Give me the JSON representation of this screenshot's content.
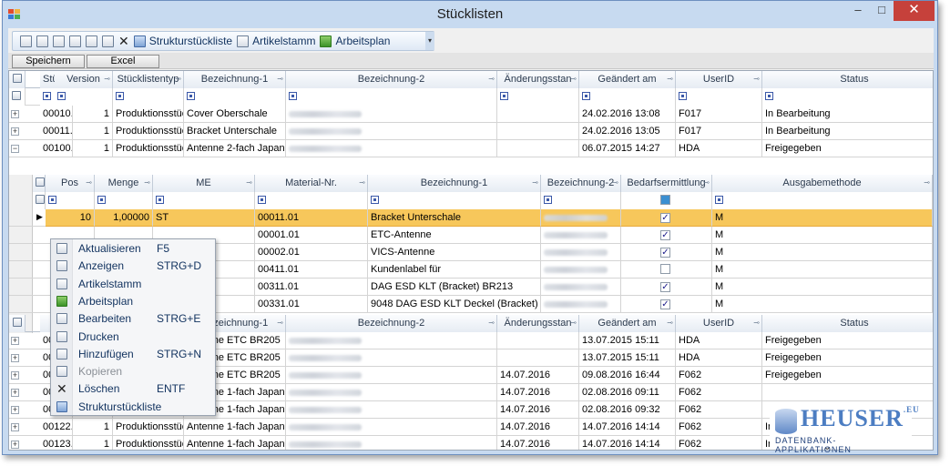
{
  "window": {
    "title": "Stücklisten",
    "min": "–",
    "max": "□",
    "close": "✕"
  },
  "toolbar": {
    "strukt": "Strukturstückliste",
    "artikel": "Artikelstamm",
    "arbeitsplan": "Arbeitsplan",
    "chevron": "▾"
  },
  "buttons": {
    "save": "Speichern",
    "excel": "Excel"
  },
  "grid": {
    "headers": [
      "Stücklisten",
      "Version",
      "Stücklistentyp",
      "Bezeichnung-1",
      "Bezeichnung-2",
      "Änderungsstan",
      "Geändert am",
      "UserID",
      "Status"
    ],
    "rows": [
      [
        "00010.01",
        "1",
        "Produktionsstückliste",
        "Cover Oberschale",
        "",
        "",
        "24.02.2016 13:08",
        "F017",
        "In Bearbeitung"
      ],
      [
        "00011.01",
        "1",
        "Produktionsstückliste",
        "Bracket Unterschale",
        "",
        "",
        "24.02.2016 13:05",
        "F017",
        "In Bearbeitung"
      ],
      [
        "00100.01",
        "1",
        "Produktionsstückliste",
        "Antenne 2-fach Japan",
        "",
        "",
        "06.07.2015 14:27",
        "HDA",
        "Freigegeben"
      ]
    ],
    "rows2": [
      [
        "",
        "",
        "",
        "Antenne ETC BR205",
        "",
        "",
        "13.07.2015 15:11",
        "HDA",
        "Freigegeben"
      ],
      [
        "",
        "",
        "",
        "Antenne ETC BR205",
        "",
        "",
        "13.07.2015 15:11",
        "HDA",
        "Freigegeben"
      ],
      [
        "",
        "",
        "",
        "Antenne ETC BR205",
        "",
        "14.07.2016",
        "09.08.2016 16:44",
        "F062",
        "Freigegeben"
      ],
      [
        "",
        "1",
        "Produktionsstückliste",
        "Antenne 1-fach Japan ni",
        "",
        "14.07.2016",
        "02.08.2016 09:11",
        "F062",
        ""
      ],
      [
        "00121.01",
        "1",
        "Produktionsstückliste",
        "Antenne 1-fach Japan L",
        "",
        "14.07.2016",
        "02.08.2016 09:32",
        "F062",
        ""
      ],
      [
        "00122.01",
        "1",
        "Produktionsstückliste",
        "Antenne 1-fach Japan ni",
        "",
        "14.07.2016",
        "14.07.2016 14:14",
        "F062",
        "In Bearbeitung"
      ],
      [
        "00123.01",
        "1",
        "Produktionsstückliste",
        "Antenne 1-fach Japan L",
        "",
        "14.07.2016",
        "14.07.2016 14:14",
        "F062",
        "In Bearbeitung"
      ]
    ],
    "rows2_col0_partial": [
      "00",
      "00",
      "00",
      "00120.01"
    ],
    "second_header_partial": "S",
    "second_header_type": "listentyp"
  },
  "detail": {
    "headers": [
      "Pos",
      "Menge",
      "ME",
      "Material-Nr.",
      "Bezeichnung-1",
      "Bezeichnung-2",
      "Bedarfsermittlung",
      "Ausgabemethode"
    ],
    "rows": [
      {
        "pos": "10",
        "menge": "1,00000",
        "me": "ST",
        "mat": "00011.01",
        "bez1": "Bracket Unterschale",
        "checked": true,
        "ausgabe": "M"
      },
      {
        "pos": "",
        "menge": "",
        "me": "",
        "mat": "00001.01",
        "bez1": "ETC-Antenne",
        "checked": true,
        "ausgabe": "M"
      },
      {
        "pos": "",
        "menge": "",
        "me": "",
        "mat": "00002.01",
        "bez1": "VICS-Antenne",
        "checked": true,
        "ausgabe": "M"
      },
      {
        "pos": "",
        "menge": "",
        "me": "",
        "mat": "00411.01",
        "bez1": "Kundenlabel für",
        "checked": false,
        "ausgabe": "M"
      },
      {
        "pos": "",
        "menge": "",
        "me": "",
        "mat": "00311.01",
        "bez1": "DAG ESD KLT (Bracket) BR213",
        "checked": true,
        "ausgabe": "M"
      },
      {
        "pos": "",
        "menge": "",
        "me": "",
        "mat": "00331.01",
        "bez1": "9048 DAG ESD KLT Deckel (Bracket) B",
        "checked": true,
        "ausgabe": "M"
      }
    ]
  },
  "context_menu": [
    {
      "label": "Aktualisieren",
      "key": "F5",
      "enabled": true
    },
    {
      "label": "Anzeigen",
      "key": "STRG+D",
      "enabled": true
    },
    {
      "label": "Artikelstamm",
      "key": "",
      "enabled": true
    },
    {
      "label": "Arbeitsplan",
      "key": "",
      "enabled": true
    },
    {
      "label": "Bearbeiten",
      "key": "STRG+E",
      "enabled": true
    },
    {
      "label": "Drucken",
      "key": "",
      "enabled": true
    },
    {
      "label": "Hinzufügen",
      "key": "STRG+N",
      "enabled": true
    },
    {
      "label": "Kopieren",
      "key": "",
      "enabled": false
    },
    {
      "label": "Löschen",
      "key": "ENTF",
      "enabled": true
    },
    {
      "label": "Strukturstückliste",
      "key": "",
      "enabled": true
    }
  ],
  "logo": {
    "big": "HEUSER",
    "tld": ".EU",
    "sub": "DATENBANK-APPLIKATIONEN"
  }
}
